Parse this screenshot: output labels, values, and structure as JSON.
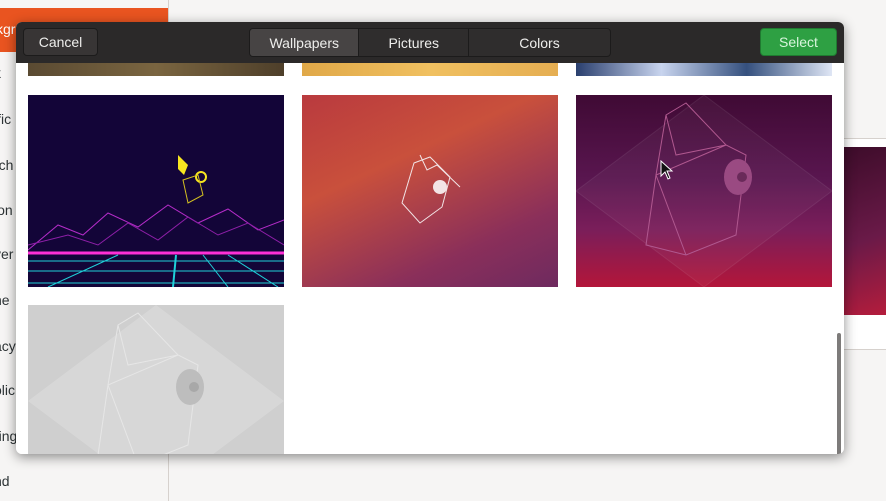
{
  "background_window": {
    "sidebar_fragments": [
      "kgr",
      "k",
      "ific",
      "rch",
      "ion",
      "ver",
      "ne",
      "acy",
      "olic",
      "ring",
      "nd"
    ]
  },
  "dialog": {
    "cancel_label": "Cancel",
    "select_label": "Select",
    "tabs": [
      {
        "label": "Wallpapers",
        "active": true
      },
      {
        "label": "Pictures",
        "active": false
      },
      {
        "label": "Colors",
        "active": false
      }
    ],
    "colors": {
      "headerbar": "#2b2929",
      "select_button": "#2ea043",
      "accent": "#e95420"
    }
  },
  "wallpapers": [
    {
      "name": "partial-brown-texture"
    },
    {
      "name": "partial-sand"
    },
    {
      "name": "partial-blue-rock"
    },
    {
      "name": "retro-synthwave-grid"
    },
    {
      "name": "orange-purple-gradient-hippo"
    },
    {
      "name": "purple-red-hippo"
    },
    {
      "name": "grey-hippo"
    }
  ]
}
